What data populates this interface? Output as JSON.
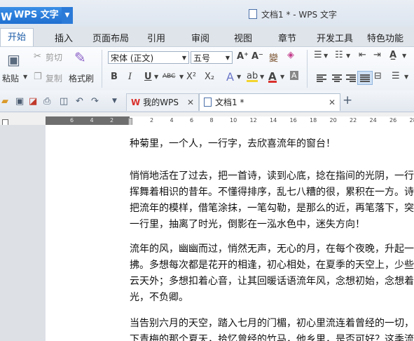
{
  "app": {
    "name": "WPS 文字",
    "logo": "W",
    "window_title": "文档1 * - WPS 文字"
  },
  "menu_tabs": [
    "开始",
    "插入",
    "页面布局",
    "引用",
    "审阅",
    "视图",
    "章节",
    "开发工具",
    "特色功能"
  ],
  "ribbon": {
    "paste": "粘贴",
    "cut": "剪切",
    "copy": "复制",
    "format_painter": "格式刷",
    "font_name": "宋体 (正文)",
    "font_size": "五号",
    "bold": "B",
    "italic": "I",
    "underline": "U",
    "strikethrough": "ABC",
    "superscript": "X²",
    "subscript": "X₂",
    "text_effect": "A",
    "font_color": "A",
    "grow_font": "A⁺",
    "shrink_font": "A⁻",
    "colors": {
      "highlight": "#f3d431",
      "font_color": "#d9302c",
      "accent": "#2b7ad8"
    }
  },
  "doc_tabs": [
    {
      "label": "我的WPS",
      "icon": "wps-logo-icon",
      "active": false
    },
    {
      "label": "文档1 *",
      "icon": "document-icon",
      "active": true
    }
  ],
  "ruler": {
    "numbers": [
      "6",
      "4",
      "2",
      "",
      "2",
      "4",
      "6",
      "8",
      "10",
      "12",
      "14",
      "16",
      "18",
      "20",
      "22",
      "24",
      "26",
      "28"
    ]
  },
  "document": {
    "paragraphs": [
      [
        "种菊里，一个人，一行字，去欣喜流年的窗台！"
      ],
      [
        "悄悄地活在了过去，把一首诗，读到心底，捻在指间的光阴，一行",
        "挥舞着相识的昔年。不懂得排序，乱七八糟的很，累积在一方。诗心",
        "把流年的模样，借笔涂抹，一笔勾勒，是那么的近，再笔落下，突然",
        "一行里，抽离了时光，倒影在一泓水色中，迷失方向！"
      ],
      [
        "流年的风，幽幽而过，悄然无声，无心的月，在每个夜晚，升起一泓",
        "拂。多想每次都是花开的相逢，初心相处，在夏季的天空上，少些阳",
        "云天外；多想扣着心音，让其回暖话语流年风，念想初始，念想着",
        "光，不负卿。"
      ],
      [
        "当告别六月的天空，踏入七月的门楣，初心里流连着曾经的一切，几",
        "下青梅的那个夏天，拾忆曾经的竹马，他乡里，是否可好？这季流转"
      ]
    ]
  }
}
